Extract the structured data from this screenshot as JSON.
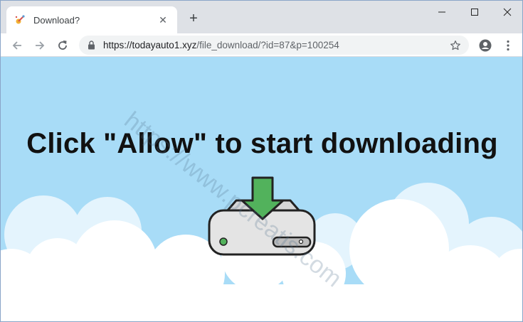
{
  "browser": {
    "tab": {
      "title": "Download?",
      "favicon": "fireworks-icon",
      "close": "✕"
    },
    "new_tab": "+",
    "window_controls": {
      "minimize": "—",
      "maximize": "☐",
      "close": "✕"
    },
    "toolbar": {
      "url_host": "https://todayauto1.xyz",
      "url_path": "/file_download/?id=87&p=100254"
    }
  },
  "page": {
    "headline": "Click \"Allow\" to start downloading",
    "watermark": "https://www.pcreatis.com"
  },
  "colors": {
    "sky": "#a8dcf7",
    "cloud": "#ffffff",
    "cloud_back": "#e4f4fd",
    "arrow": "#52b25c",
    "drive_body": "#e4e4e4",
    "led": "#52b25c"
  }
}
